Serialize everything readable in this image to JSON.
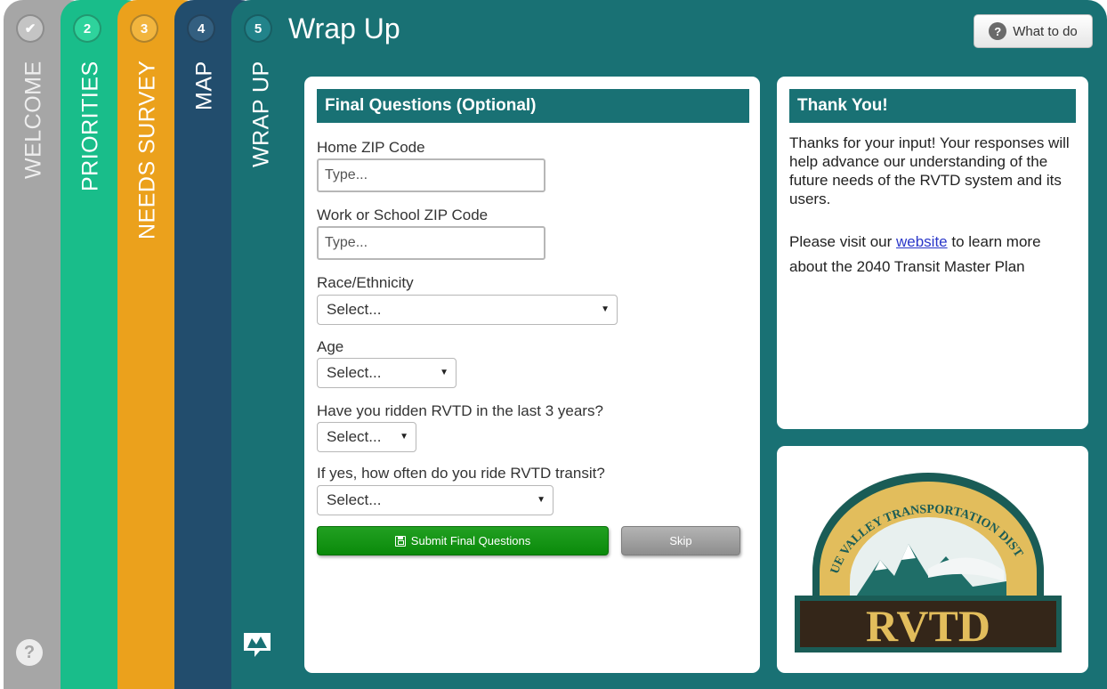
{
  "tabs": [
    {
      "num": "✔",
      "label": "WELCOME"
    },
    {
      "num": "2",
      "label": "PRIORITIES"
    },
    {
      "num": "3",
      "label": "NEEDS SURVEY"
    },
    {
      "num": "4",
      "label": "MAP"
    },
    {
      "num": "5",
      "label": "WRAP UP"
    }
  ],
  "help_icon": "question-circle-icon",
  "brand_icon": "metroquest-logo-icon",
  "page_title": "Wrap Up",
  "what_to_do": {
    "icon": "?",
    "label": "What to do"
  },
  "questions": {
    "header": "Final Questions (Optional)",
    "home_zip": {
      "label": "Home ZIP Code",
      "placeholder": "Type..."
    },
    "work_zip": {
      "label": "Work or School ZIP Code",
      "placeholder": "Type..."
    },
    "race": {
      "label": "Race/Ethnicity",
      "value": "Select..."
    },
    "age": {
      "label": "Age",
      "value": "Select..."
    },
    "ridden": {
      "label": "Have you ridden RVTD in the last 3 years?",
      "value": "Select..."
    },
    "how_often": {
      "label": "If yes, how often do you ride RVTD transit?",
      "value": "Select..."
    },
    "submit_label": "Submit Final Questions",
    "skip_label": "Skip"
  },
  "thanks": {
    "header": "Thank You!",
    "text": "Thanks for your input! Your responses will help advance our understanding of the future needs of the RVTD system and its users.",
    "visit_before": "Please visit our ",
    "link_text": "website",
    "visit_after": " to learn more about the 2040 Transit Master Plan"
  },
  "logo": {
    "arc_text": "ROGUE VALLEY TRANSPORTATION DISTRICT",
    "name": "RVTD"
  },
  "colors": {
    "welcome": "#a6a6a6",
    "priorities": "#19bd8a",
    "needs_survey": "#eba11c",
    "map": "#224d6d",
    "wrap_up": "#197174",
    "submit": "#0a8a0a"
  }
}
